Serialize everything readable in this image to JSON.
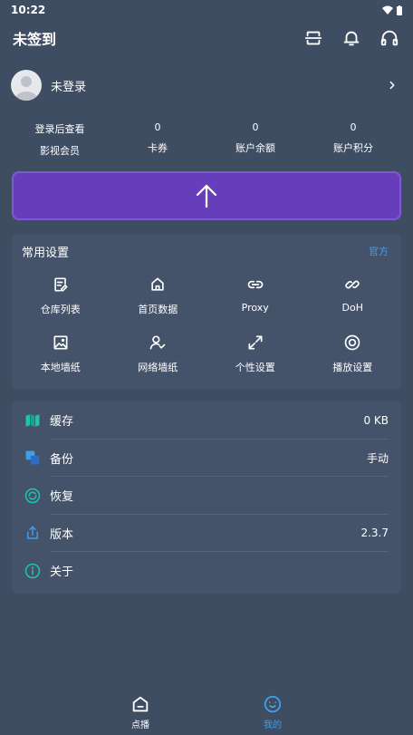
{
  "status": {
    "time": "10:22"
  },
  "header": {
    "title": "未签到"
  },
  "user": {
    "name": "未登录"
  },
  "stats": [
    {
      "value": "登录后查看",
      "label": "影视会员"
    },
    {
      "value": "0",
      "label": "卡券"
    },
    {
      "value": "0",
      "label": "账户余额"
    },
    {
      "value": "0",
      "label": "账户积分"
    }
  ],
  "settings": {
    "title": "常用设置",
    "link": "官方",
    "items": [
      {
        "label": "仓库列表",
        "icon": "document-edit-icon"
      },
      {
        "label": "首页数据",
        "icon": "home-icon"
      },
      {
        "label": "Proxy",
        "icon": "link-icon"
      },
      {
        "label": "DoH",
        "icon": "chain-icon"
      },
      {
        "label": "本地墙纸",
        "icon": "image-icon"
      },
      {
        "label": "网络墙纸",
        "icon": "user-check-icon"
      },
      {
        "label": "个性设置",
        "icon": "expand-icon"
      },
      {
        "label": "播放设置",
        "icon": "play-circle-icon"
      }
    ]
  },
  "list": [
    {
      "label": "缓存",
      "value": "0 KB",
      "icon": "map-icon"
    },
    {
      "label": "备份",
      "value": "手动",
      "icon": "copy-icon"
    },
    {
      "label": "恢复",
      "value": "",
      "icon": "refresh-icon"
    },
    {
      "label": "版本",
      "value": "2.3.7",
      "icon": "share-icon"
    },
    {
      "label": "关于",
      "value": "",
      "icon": "info-icon"
    }
  ],
  "nav": [
    {
      "label": "点播"
    },
    {
      "label": "我的"
    }
  ],
  "colors": {
    "background": "#3f4d63",
    "card": "#45536a",
    "accent": "#3f9ee6",
    "upload": "#663ebb",
    "teal": "#20c3b0"
  }
}
